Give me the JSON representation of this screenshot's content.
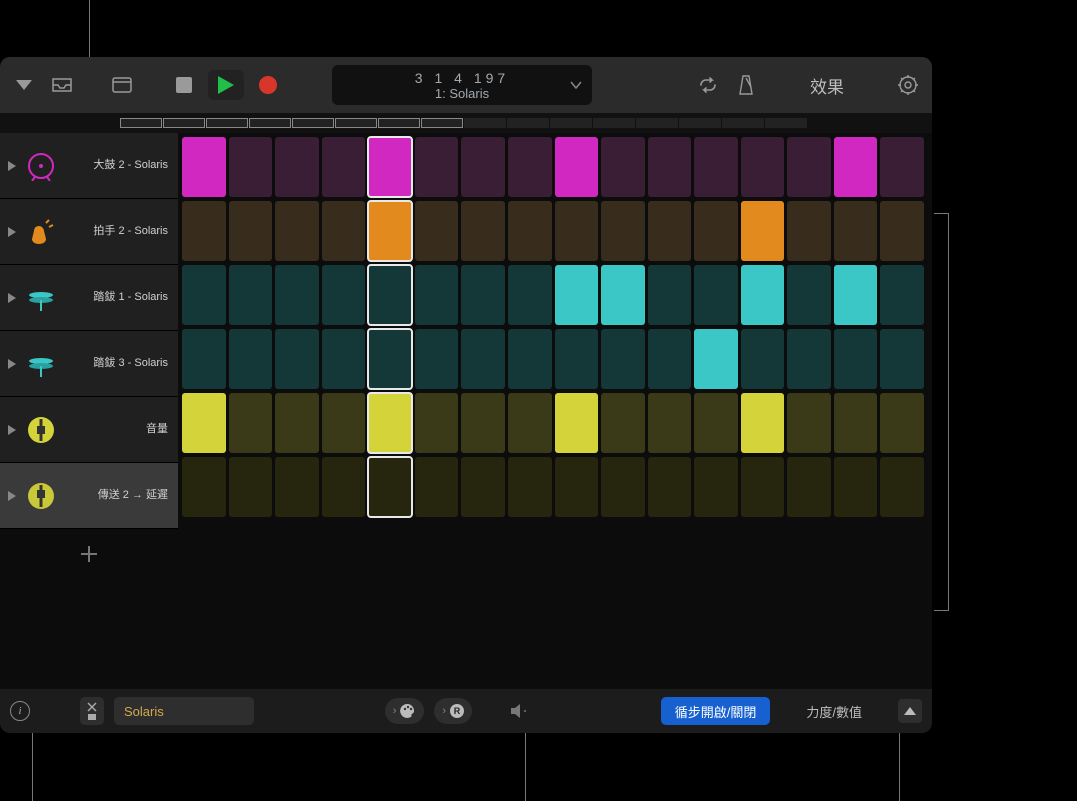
{
  "transport": {
    "position": "3  1  4  197",
    "pattern_label": "1: Solaris"
  },
  "toolbar": {
    "fx_label": "效果"
  },
  "tracks": [
    {
      "label": "大鼓 2 - Solaris",
      "icon": "kick",
      "color": "magenta",
      "selected": false
    },
    {
      "label": "拍手 2 - Solaris",
      "icon": "clap",
      "color": "orange",
      "selected": false
    },
    {
      "label": "踏鈸 1 - Solaris",
      "icon": "hihat",
      "color": "teal",
      "selected": false
    },
    {
      "label": "踏鈸 3 - Solaris",
      "icon": "hihat",
      "color": "teal",
      "selected": false
    },
    {
      "label": "音量",
      "icon": "vol",
      "color": "yellow",
      "selected": false
    },
    {
      "label": "傳送 2 → 延遲",
      "icon": "send",
      "color": "olive",
      "selected": true
    }
  ],
  "playhead_step": 4,
  "grid": [
    [
      1,
      0,
      0,
      0,
      1,
      0,
      0,
      0,
      1,
      0,
      0,
      0,
      0,
      0,
      1,
      0
    ],
    [
      0,
      0,
      0,
      0,
      1,
      0,
      0,
      0,
      0,
      0,
      0,
      0,
      1,
      0,
      0,
      0
    ],
    [
      0,
      0,
      0,
      0,
      0,
      0,
      0,
      0,
      1,
      1,
      0,
      0,
      1,
      0,
      1,
      0
    ],
    [
      0,
      0,
      0,
      0,
      0,
      0,
      0,
      0,
      0,
      0,
      0,
      1,
      0,
      0,
      0,
      0
    ],
    [
      1,
      0,
      0,
      0,
      1,
      0,
      0,
      0,
      1,
      0,
      0,
      0,
      1,
      0,
      0,
      0
    ],
    [
      0,
      0,
      0,
      0,
      0,
      0,
      0,
      0,
      0,
      0,
      0,
      0,
      0,
      0,
      0,
      0
    ]
  ],
  "bottom": {
    "pattern_name": "Solaris",
    "loop_toggle_label": "循步開啟/關閉",
    "edit_mode_label": "力度/數值"
  }
}
